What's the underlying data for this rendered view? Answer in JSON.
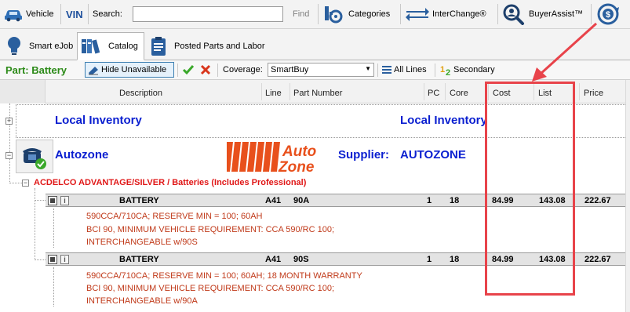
{
  "toolbar": {
    "vehicle_label": "Vehicle",
    "vin_label": "VIN",
    "search_label": "Search:",
    "search_value": "",
    "find_label": "Find",
    "categories_label": "Categories",
    "interchange_label": "InterChange®",
    "buyerassist_label": "BuyerAssist™"
  },
  "tabs": [
    {
      "label": "Smart eJob",
      "icon": "lightbulb-icon"
    },
    {
      "label": "Catalog",
      "icon": "books-icon",
      "active": true
    },
    {
      "label": "Posted Parts and Labor",
      "icon": "clipboard-icon"
    }
  ],
  "filterbar": {
    "part_label": "Part: Battery",
    "hide_unavailable_label": "Hide Unavailable",
    "coverage_label": "Coverage:",
    "coverage_value": "SmartBuy",
    "all_lines_label": "All Lines",
    "secondary_label": "Secondary"
  },
  "columns": [
    "Description",
    "Line",
    "Part Number",
    "PC",
    "Core",
    "Cost",
    "List",
    "Price"
  ],
  "local_inventory": {
    "label_left": "Local Inventory",
    "label_right": "Local Inventory"
  },
  "supplier_group": {
    "name": "Autozone",
    "supplier_label": "Supplier:",
    "supplier_value": "AUTOZONE",
    "logo_text_top": "Auto",
    "logo_text_bottom": "Zone"
  },
  "category": "ACDELCO ADVANTAGE/SILVER / Batteries (Includes Professional)",
  "parts": [
    {
      "description": "BATTERY",
      "line": "A41",
      "part_number": "90A",
      "pc": "1",
      "core": "18",
      "cost": "84.99",
      "list": "143.08",
      "price": "222.67",
      "details": [
        "590CCA/710CA; RESERVE MIN = 100; 60AH",
        "BCI 90, MINIMUM VEHICLE REQUIREMENT: CCA 590/RC 100;",
        "INTERCHANGEABLE w/90S"
      ]
    },
    {
      "description": "BATTERY",
      "line": "A41",
      "part_number": "90S",
      "pc": "1",
      "core": "18",
      "cost": "84.99",
      "list": "143.08",
      "price": "222.67",
      "details": [
        "590CCA/710CA; RESERVE MIN = 100; 60AH; 18 MONTH WARRANTY",
        "BCI 90, MINIMUM VEHICLE REQUIREMENT: CCA 590/RC 100;",
        "INTERCHANGEABLE w/90A"
      ]
    }
  ],
  "colors": {
    "accent_blue": "#0a1fd0",
    "category_red": "#e01717",
    "detail_text": "#c03a1a",
    "part_label_green": "#2b8a17",
    "annotation_red": "#e8434a",
    "autozone_orange": "#e8501c"
  }
}
